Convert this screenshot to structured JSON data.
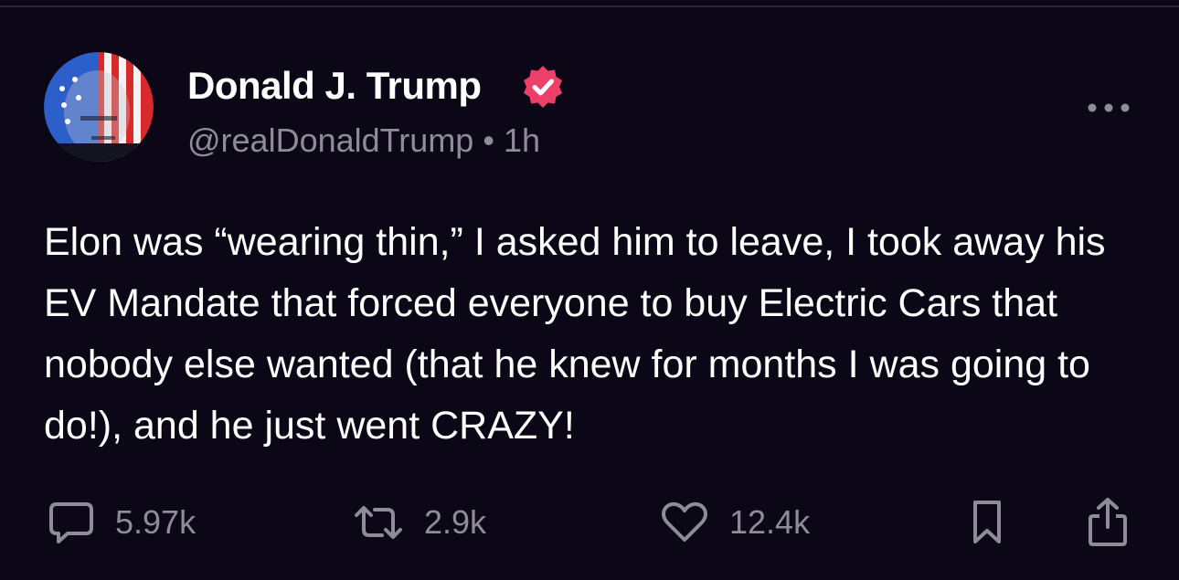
{
  "post": {
    "author_name": "Donald J. Trump",
    "handle": "@realDonaldTrump",
    "separator": "•",
    "time": "1h",
    "verified": true,
    "body": "Elon was “wearing thin,” I asked him to leave, I took away his EV Mandate that forced everyone to buy Electric Cars that nobody else wanted (that he knew for months I was going to do!), and he just went CRAZY!"
  },
  "actions": {
    "replies": "5.97k",
    "reposts": "2.9k",
    "likes": "12.4k"
  },
  "icons": {
    "verified": "verified-badge-icon",
    "more": "more-options-icon",
    "reply": "comment-icon",
    "repost": "repost-icon",
    "like": "heart-icon",
    "bookmark": "bookmark-icon",
    "share": "share-icon"
  },
  "colors": {
    "background": "#0b0716",
    "verified_badge": "#ee3f6b",
    "muted_text": "#8f8c99"
  }
}
